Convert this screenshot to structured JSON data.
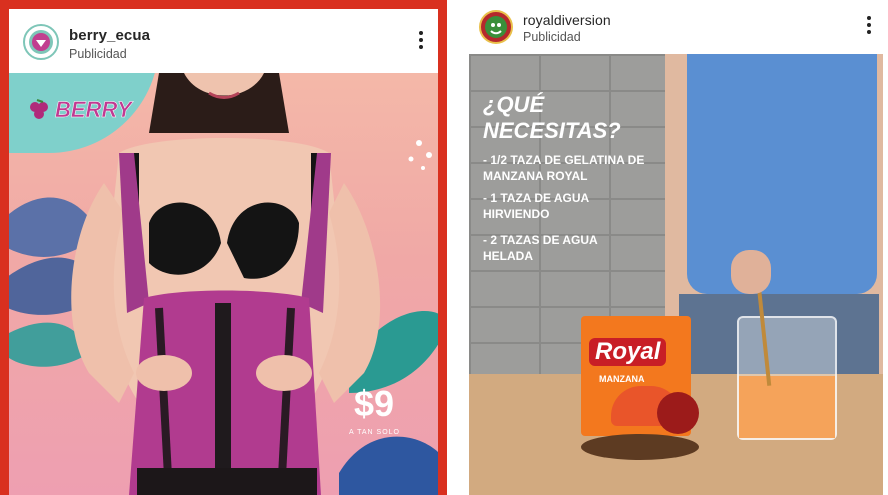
{
  "left_post": {
    "username": "berry_ecua",
    "sponsored_label": "Publicidad",
    "brand_badge": "BERRY",
    "price": "$9",
    "price_caption": "A TAN SOLO",
    "colors": {
      "frame": "#d9301f",
      "accent": "#b23b8f"
    }
  },
  "right_post": {
    "username": "royaldiversion",
    "sponsored_label": "Publicidad",
    "question": "¿QUÉ NECESITAS?",
    "ingredients": [
      "- 1/2 TAZA DE GELATINA DE MANZANA ROYAL",
      "- 1 TAZA DE AGUA HIRVIENDO",
      "- 2 TAZAS DE AGUA HELADA"
    ],
    "package_label": "Royal",
    "package_flavor": "MANZANA"
  }
}
